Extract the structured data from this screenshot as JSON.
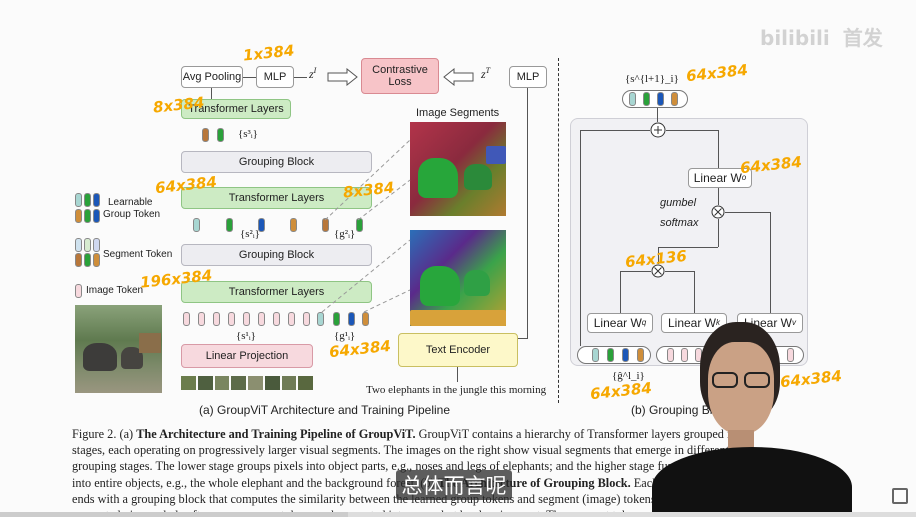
{
  "left_panel": {
    "avg_pooling": "Avg Pooling",
    "mlp_image": "MLP",
    "z_image": "z",
    "z_image_sup": "I",
    "contrastive_loss_line1": "Contrastive",
    "contrastive_loss_line2": "Loss",
    "z_text": "z",
    "z_text_sup": "T",
    "mlp_text": "MLP",
    "transformer_layers_top": "Transformer Layers",
    "transformer_layers_mid": "Transformer Layers",
    "transformer_layers_bottom": "Transformer Layers",
    "grouping_block_top": "Grouping Block",
    "grouping_block_bottom": "Grouping Block",
    "linear_projection": "Linear Projection",
    "text_encoder": "Text Encoder",
    "image_segments_title": "Image Segments",
    "caption_sentence": "Two elephants in the jungle this morning",
    "s3_label": "{s³ᵢ}",
    "s2_label": "{s²ᵢ}",
    "g2_label": "{g²ᵢ}",
    "s1_label": "{s¹ᵢ}",
    "g1_label": "{g¹ᵢ}",
    "subtitle": "(a) GroupViT Architecture and Training Pipeline"
  },
  "legend": {
    "learnable_line1": "Learnable",
    "learnable_line2": "Group Token",
    "segment_token": "Segment Token",
    "image_token": "Image Token"
  },
  "right_panel": {
    "top_label": "{s^{l+1}_i}",
    "linear_wo": "Linear W",
    "linear_wo_sub": "o",
    "gumbel": "gumbel",
    "softmax": "softmax",
    "linear_wq": "Linear W",
    "linear_wq_sub": "q",
    "linear_wk": "Linear W",
    "linear_wk_sub": "k",
    "linear_wv": "Linear W",
    "linear_wv_sub": "v",
    "g_label": "{ĝ^l_i}",
    "subtitle": "(b) Grouping Bl"
  },
  "annotations": {
    "a1": "1x384",
    "a2": "8x384",
    "a3": "64x384",
    "a4": "8x384",
    "a5": "196x384",
    "a6": "64x384",
    "a7": "64x384",
    "a8": "64x384",
    "a9": "64x136",
    "a10": "64x384",
    "a11": "64x384"
  },
  "caption": {
    "line1_prefix": "Figure 2. (a) ",
    "line1_bold": "The Architecture and Training Pipeline of GroupViT.",
    "line1_rest": " GroupViT contains a hierarchy of Transformer layers grouped into",
    "line2": "stages, each operating on progressively larger visual segments. The images on the right show visual segments that emerge in different",
    "line3": "grouping stages. The lower stage groups pixels into object parts, e.g., noses and legs of elephants; and the higher stage further merges them",
    "line4_prefix": "into entire objects, e.g., the whole elephant and the background forest. (b) ",
    "line4_bold": "The Architecture of Grouping Block.",
    "line4_rest": " Each grouping stage",
    "line5": "ends with a grouping block that computes the similarity between the learned group tokens and segment (image) tokens. The assignment is",
    "line6": "computed via gumbel softmax over group tokens and converted into a one-hot hard assignment. The segment tokens assigned to the same"
  },
  "watermark": {
    "logo": "bilibili",
    "tag": "首发"
  },
  "subtitle_overlay": "总体而言呢",
  "colors": {
    "annotation": "#f6a800",
    "green_block": "#cdebc4",
    "gray_block": "#ededf1",
    "pink_block": "#f7d9de",
    "contrastive": "#f7c4c8",
    "text_encoder": "#fdf8c9"
  }
}
